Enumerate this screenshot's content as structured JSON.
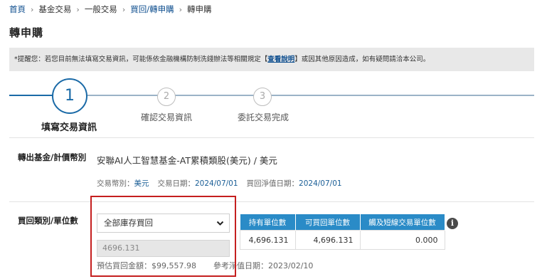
{
  "breadcrumb": {
    "items": [
      {
        "label": "首頁",
        "link": true
      },
      {
        "label": "基金交易",
        "link": false
      },
      {
        "label": "一般交易",
        "link": false
      },
      {
        "label": "買回/轉申購",
        "link": true
      },
      {
        "label": "轉申購",
        "link": false
      }
    ],
    "separator": "›"
  },
  "page_title": "轉申購",
  "notice": {
    "prefix": "*提醒您：若您目前無法填寫交易資訊，可能係依金融機構防制洗錢辦法等相關規定【",
    "link_label": "查看說明",
    "suffix": "】或因其他原因造成，如有疑問請洽本公司。"
  },
  "stepper": {
    "steps": [
      {
        "number": "1",
        "label": "填寫交易資訊",
        "active": true
      },
      {
        "number": "2",
        "label": "確認交易資訊",
        "active": false
      },
      {
        "number": "3",
        "label": "委託交易完成",
        "active": false
      }
    ]
  },
  "transfer_out": {
    "label": "轉出基金/計價幣別",
    "fund_name": "安聯AI人工智慧基金-AT累積類股(美元) / 美元",
    "currency_label": "交易幣別：",
    "currency_value": "美元",
    "trade_date_label": "交易日期：",
    "trade_date_value": "2024/07/01",
    "nav_date_label": "買回淨值日期：",
    "nav_date_value": "2024/07/01"
  },
  "redemption": {
    "label": "買回類別/單位數",
    "select_value": "全部庫存買回",
    "units_value": "4696.131",
    "estimate_label": "預估買回金額：",
    "estimate_value": "$99,557.98",
    "ref_date_label": "參考淨值日期：",
    "ref_date_value": "2023/02/10"
  },
  "units_table": {
    "headers": [
      "持有單位數",
      "可買回單位數",
      "觸及短線交易單位數"
    ],
    "values": [
      "4,696.131",
      "4,696.131",
      "0.000"
    ]
  },
  "icons": {
    "select": "chevron-down-icon",
    "info": "info-icon"
  },
  "colors": {
    "accent": "#1a6aa7",
    "table_header": "#2a8bc7",
    "highlight": "#c51f1f"
  }
}
